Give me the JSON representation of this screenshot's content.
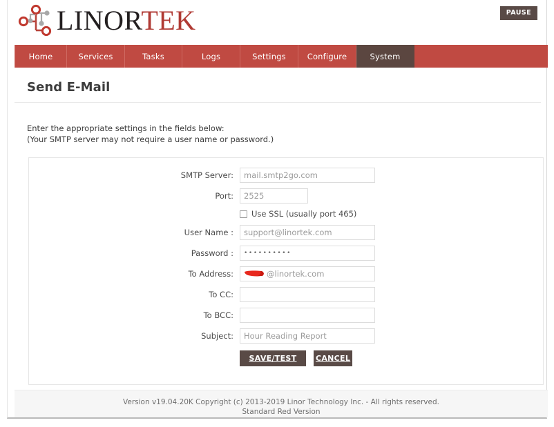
{
  "brand": {
    "name_dark": "LINOR",
    "name_red": "TEK",
    "logo_icon": "linortek-circuit-logo-icon",
    "accent_red": "#b03a34",
    "nav_red": "#c04a42",
    "dark_brown": "#594a46"
  },
  "header": {
    "pause_label": "PAUSE"
  },
  "nav": {
    "items": [
      {
        "label": "Home",
        "active": false
      },
      {
        "label": "Services",
        "active": false
      },
      {
        "label": "Tasks",
        "active": false
      },
      {
        "label": "Logs",
        "active": false
      },
      {
        "label": "Settings",
        "active": false
      },
      {
        "label": "Configure",
        "active": false
      },
      {
        "label": "System",
        "active": true
      }
    ]
  },
  "main": {
    "title": "Send E-Mail",
    "intro_line1": "Enter the appropriate settings in the fields below:",
    "intro_line2": "(Your SMTP server may not require a user name or password.)"
  },
  "form": {
    "fields": [
      {
        "label": "SMTP Server:",
        "value": "mail.smtp2go.com",
        "name": "smtp-server"
      },
      {
        "label": "Port:",
        "value": "2525",
        "name": "port"
      },
      {
        "label": "User Name :",
        "value": "support@linortek.com",
        "name": "user-name"
      },
      {
        "label": "Password :",
        "value": "••••••••••",
        "name": "password"
      },
      {
        "label": "To Address:",
        "value": "@linortek.com",
        "name": "to-address"
      },
      {
        "label": "To CC:",
        "value": "",
        "name": "to-cc"
      },
      {
        "label": "To BCC:",
        "value": "",
        "name": "to-bcc"
      },
      {
        "label": "Subject:",
        "value": "Hour Reading Report",
        "name": "subject"
      }
    ],
    "labels": {
      "smtp_server": "SMTP Server:",
      "port": "Port:",
      "user_name": "User Name :",
      "password": "Password :",
      "to_address": "To Address:",
      "to_cc": "To CC:",
      "to_bcc": "To BCC:",
      "subject": "Subject:"
    },
    "values": {
      "smtp_server": "mail.smtp2go.com",
      "port": "2525",
      "user_name": "support@linortek.com",
      "password": "••••••••••",
      "to_address_suffix": "@linortek.com",
      "to_cc": "",
      "to_bcc": "",
      "subject": "Hour Reading Report"
    },
    "ssl": {
      "label": "Use SSL (usually port 465)",
      "checked": false
    },
    "buttons": {
      "save": "SAVE/TEST",
      "cancel": "CANCEL"
    }
  },
  "footer": {
    "line1": "Version v19.04.20K Copyright (c) 2013-2019 Linor Technology Inc. - All rights reserved.",
    "line2": "Standard Red Version"
  }
}
